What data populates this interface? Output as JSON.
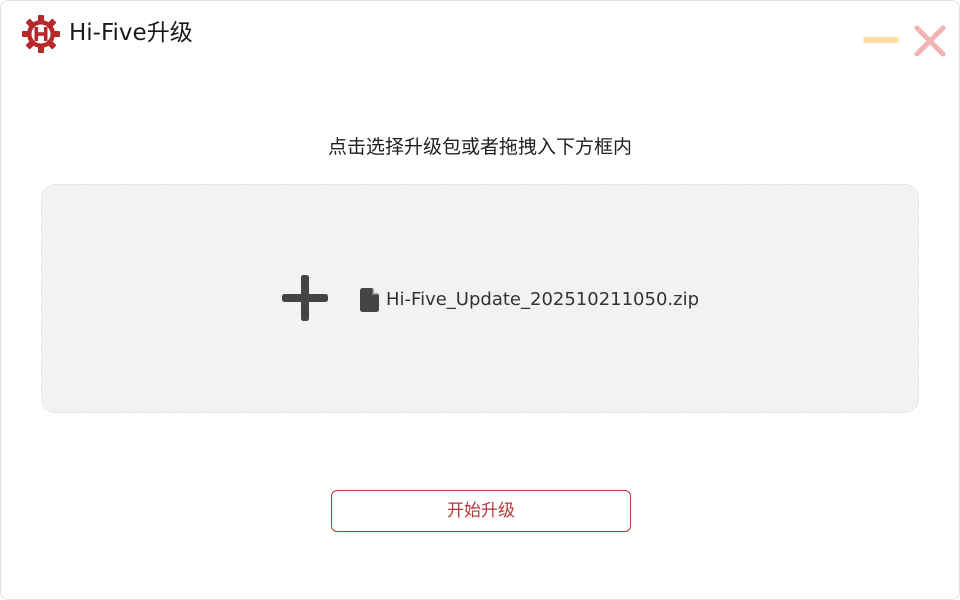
{
  "window": {
    "title": "Hi-Five升级"
  },
  "icons": {
    "logo": "hi-five-gear-logo-icon",
    "minimize": "minimize-icon",
    "close": "close-icon",
    "add": "plus-icon",
    "file": "file-icon"
  },
  "main": {
    "instruction": "点击选择升级包或者拖拽入下方框内",
    "dropzone": {
      "file_name": "Hi-Five_Update_202510211050.zip"
    },
    "start_button_label": "开始升级"
  },
  "colors": {
    "brand_red": "#b23a3a",
    "logo_red": "#b8282a",
    "minimize_yellow": "#fde0a0",
    "close_pink": "#f2b3b3",
    "dropzone_bg": "#f2f2f2",
    "icon_dark": "#444444"
  }
}
